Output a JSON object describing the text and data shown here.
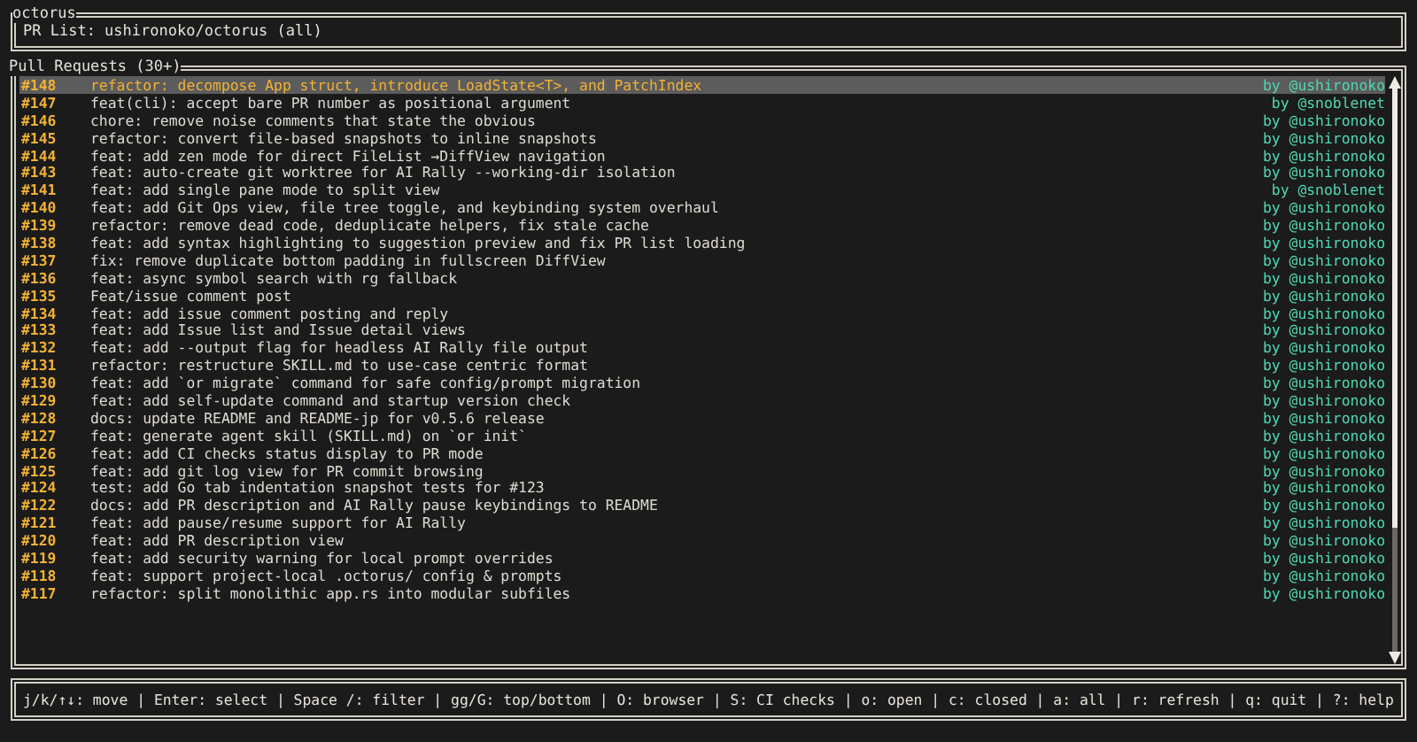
{
  "app": {
    "title": "octorus",
    "subtitle": "PR List: ushironoko/octorus (all)"
  },
  "pull_requests": {
    "title": "Pull Requests (30+)",
    "rows": [
      {
        "number": "#148",
        "title": "refactor: decompose App struct, introduce LoadState<T>, and PatchIndex",
        "author": "by @ushironoko",
        "selected": true
      },
      {
        "number": "#147",
        "title": "feat(cli): accept bare PR number as positional argument",
        "author": "by @snoblenet",
        "selected": false
      },
      {
        "number": "#146",
        "title": "chore: remove noise comments that state the obvious",
        "author": "by @ushironoko",
        "selected": false
      },
      {
        "number": "#145",
        "title": "refactor: convert file-based snapshots to inline snapshots",
        "author": "by @ushironoko",
        "selected": false
      },
      {
        "number": "#144",
        "title": "feat: add zen mode for direct FileList →DiffView navigation",
        "author": "by @ushironoko",
        "selected": false
      },
      {
        "number": "#143",
        "title": "feat: auto-create git worktree for AI Rally --working-dir isolation",
        "author": "by @ushironoko",
        "selected": false
      },
      {
        "number": "#141",
        "title": "feat: add single pane mode to split view",
        "author": "by @snoblenet",
        "selected": false
      },
      {
        "number": "#140",
        "title": "feat: add Git Ops view, file tree toggle, and keybinding system overhaul",
        "author": "by @ushironoko",
        "selected": false
      },
      {
        "number": "#139",
        "title": "refactor: remove dead code, deduplicate helpers, fix stale cache",
        "author": "by @ushironoko",
        "selected": false
      },
      {
        "number": "#138",
        "title": "feat: add syntax highlighting to suggestion preview and fix PR list loading",
        "author": "by @ushironoko",
        "selected": false
      },
      {
        "number": "#137",
        "title": "fix: remove duplicate bottom padding in fullscreen DiffView",
        "author": "by @ushironoko",
        "selected": false
      },
      {
        "number": "#136",
        "title": "feat: async symbol search with rg fallback",
        "author": "by @ushironoko",
        "selected": false
      },
      {
        "number": "#135",
        "title": "Feat/issue comment post",
        "author": "by @ushironoko",
        "selected": false
      },
      {
        "number": "#134",
        "title": "feat: add issue comment posting and reply",
        "author": "by @ushironoko",
        "selected": false
      },
      {
        "number": "#133",
        "title": "feat: add Issue list and Issue detail views",
        "author": "by @ushironoko",
        "selected": false
      },
      {
        "number": "#132",
        "title": "feat: add --output flag for headless AI Rally file output",
        "author": "by @ushironoko",
        "selected": false
      },
      {
        "number": "#131",
        "title": "refactor: restructure SKILL.md to use-case centric format",
        "author": "by @ushironoko",
        "selected": false
      },
      {
        "number": "#130",
        "title": "feat: add `or migrate` command for safe config/prompt migration",
        "author": "by @ushironoko",
        "selected": false
      },
      {
        "number": "#129",
        "title": "feat: add self-update command and startup version check",
        "author": "by @ushironoko",
        "selected": false
      },
      {
        "number": "#128",
        "title": "docs: update README and README-jp for v0.5.6 release",
        "author": "by @ushironoko",
        "selected": false
      },
      {
        "number": "#127",
        "title": "feat: generate agent skill (SKILL.md) on `or init`",
        "author": "by @ushironoko",
        "selected": false
      },
      {
        "number": "#126",
        "title": "feat: add CI checks status display to PR mode",
        "author": "by @ushironoko",
        "selected": false
      },
      {
        "number": "#125",
        "title": "feat: add git log view for PR commit browsing",
        "author": "by @ushironoko",
        "selected": false
      },
      {
        "number": "#124",
        "title": "test: add Go tab indentation snapshot tests for #123",
        "author": "by @ushironoko",
        "selected": false
      },
      {
        "number": "#122",
        "title": "docs: add PR description and AI Rally pause keybindings to README",
        "author": "by @ushironoko",
        "selected": false
      },
      {
        "number": "#121",
        "title": "feat: add pause/resume support for AI Rally",
        "author": "by @ushironoko",
        "selected": false
      },
      {
        "number": "#120",
        "title": "feat: add PR description view",
        "author": "by @ushironoko",
        "selected": false
      },
      {
        "number": "#119",
        "title": "feat: add security warning for local prompt overrides",
        "author": "by @ushironoko",
        "selected": false
      },
      {
        "number": "#118",
        "title": "feat: support project-local .octorus/ config & prompts",
        "author": "by @ushironoko",
        "selected": false
      },
      {
        "number": "#117",
        "title": "refactor: split monolithic app.rs into modular subfiles",
        "author": "by @ushironoko",
        "selected": false
      }
    ]
  },
  "status_bar": "j/k/↑↓: move | Enter: select | Space /: filter | gg/G: top/bottom | O: browser | S: CI checks | o: open | c: closed | a: all | r: refresh | q: quit | ?: help"
}
